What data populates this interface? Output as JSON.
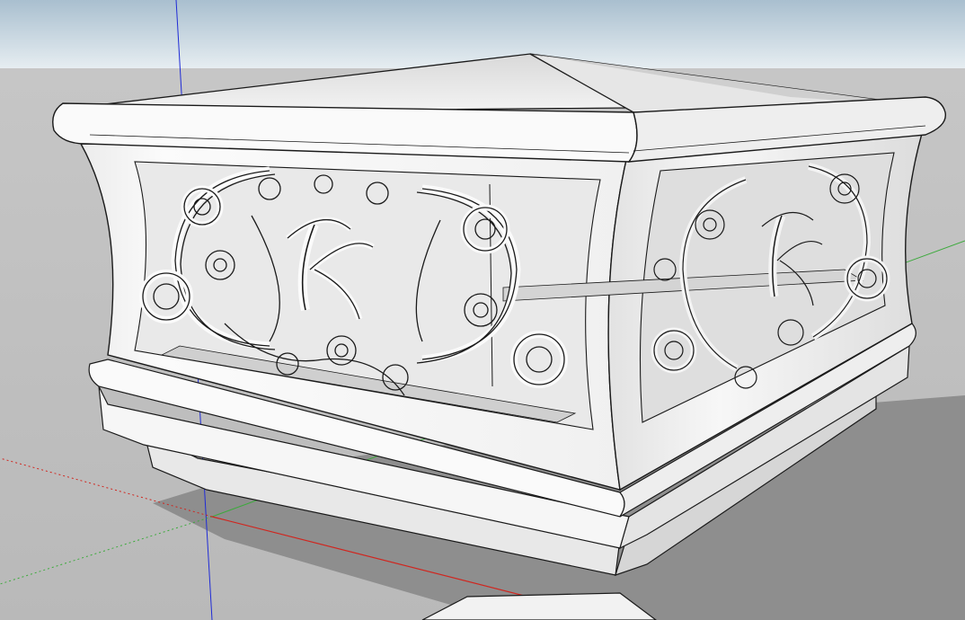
{
  "viewport": {
    "sky_top_color": "#a9bfcf",
    "sky_bottom_color": "#e6edf1",
    "ground_color": "#bdbdbd",
    "shadow_color": "#8c8c8c",
    "model_color": "#f4f4f4",
    "edge_color": "#1a1a1a"
  },
  "axes": {
    "red_axis_color": "#d0261f",
    "green_axis_color": "#3caa3c",
    "blue_axis_color": "#1f2bd6"
  },
  "model": {
    "name_icon": "post-cap-model-icon",
    "front_panel_icon": "filigree-k-monogram-icon",
    "side_panel_icon": "filigree-k-monogram-icon"
  }
}
